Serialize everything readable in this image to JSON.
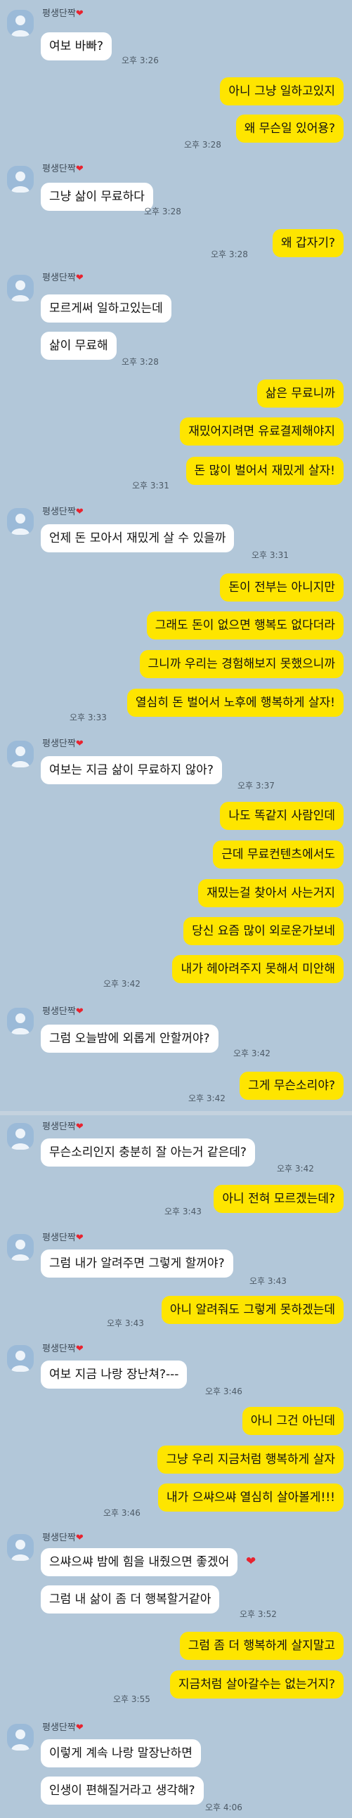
{
  "chat": {
    "sender_name": "평생단짝",
    "heart_icon": "heart-icon",
    "messages": [
      {
        "dir": "in",
        "text": "여보 바빠?"
      },
      {
        "dir": "out",
        "text": "아니 그냥 일하고있지"
      },
      {
        "dir": "out",
        "text": "왜 무슨일 있어용?"
      },
      {
        "dir": "in",
        "text": "그냥 삶이 무료하다"
      },
      {
        "dir": "out",
        "text": "왜 갑자기?"
      },
      {
        "dir": "in",
        "text": "모르게써 일하고있는데"
      },
      {
        "dir": "in",
        "text": "삶이 무료해"
      },
      {
        "dir": "out",
        "text": "삶은 무료니까"
      },
      {
        "dir": "out",
        "text": "재밌어지려면 유료결제해야지"
      },
      {
        "dir": "out",
        "text": "돈 많이 벌어서 재밌게 살자!"
      },
      {
        "dir": "in",
        "text": "언제 돈 모아서 재밌게 살 수 있을까"
      },
      {
        "dir": "out",
        "text": "돈이 전부는 아니지만"
      },
      {
        "dir": "out",
        "text": "그래도 돈이 없으면 행복도 없다더라"
      },
      {
        "dir": "out",
        "text": "그니까 우리는 경험해보지 못했으니까"
      },
      {
        "dir": "out",
        "text": "열심히 돈 벌어서 노후에 행복하게 살자!"
      },
      {
        "dir": "in",
        "text": "여보는 지금 삶이 무료하지 않아?"
      },
      {
        "dir": "out",
        "text": "나도 똑같지 사람인데"
      },
      {
        "dir": "out",
        "text": "근데 무료컨텐츠에서도"
      },
      {
        "dir": "out",
        "text": "재밌는걸 찾아서 사는거지"
      },
      {
        "dir": "out",
        "text": "당신 요즘 많이 외로운가보네"
      },
      {
        "dir": "out",
        "text": "내가 헤아려주지 못해서 미안해"
      },
      {
        "dir": "in",
        "text": "그럼 오늘밤에 외롭게 안할꺼야?"
      },
      {
        "dir": "out",
        "text": "그게 무슨소리야?"
      },
      {
        "dir": "in",
        "text": "무슨소리인지 충분히 잘 아는거 같은데?"
      },
      {
        "dir": "out",
        "text": "아니 전혀 모르겠는데?"
      },
      {
        "dir": "in",
        "text": "그럼 내가 알려주면 그렇게 할꺼야?"
      },
      {
        "dir": "out",
        "text": "아니 알려줘도 그렇게 못하겠는데"
      },
      {
        "dir": "in",
        "text": "여보 지금 나랑 장난쳐?---"
      },
      {
        "dir": "out",
        "text": "아니 그건 아닌데"
      },
      {
        "dir": "out",
        "text": "그냥 우리 지금처럼 행복하게 살자"
      },
      {
        "dir": "out",
        "text": "내가 으쌰으쌰 열심히 살아볼게!!!"
      },
      {
        "dir": "in",
        "text": "으쌰으쌰 밤에 힘을 내줬으면 좋겠어"
      },
      {
        "dir": "in",
        "text": "그럼 내 삶이 좀 더 행복할거같아"
      },
      {
        "dir": "out",
        "text": "그럼 좀 더 행복하게 살지말고"
      },
      {
        "dir": "out",
        "text": "지금처럼 살아갈수는 없는거지?"
      },
      {
        "dir": "in",
        "text": "이렇게 계속 나랑 말장난하면"
      },
      {
        "dir": "in",
        "text": "인생이 편해질거라고 생각해?"
      }
    ],
    "times": [
      "오후 3:26",
      "오후 3:28",
      "오후 3:28",
      "오후 3:28",
      "오후 3:28",
      "오후 3:31",
      "오후 3:31",
      "오후 3:33",
      "오후 3:37",
      "오후 3:42",
      "오후 3:42",
      "오후 3:42",
      "오후 3:42",
      "오후 3:43",
      "오후 3:43",
      "오후 3:43",
      "오후 3:46",
      "오후 3:46",
      "오후 3:52",
      "오후 3:55",
      "오후 4:06"
    ]
  }
}
